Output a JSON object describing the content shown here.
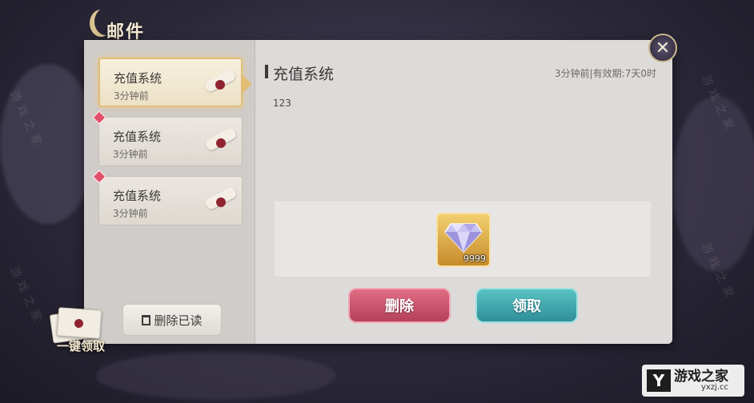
{
  "header": {
    "title": "邮件"
  },
  "close": {
    "icon": "close-icon",
    "glyph": "✕"
  },
  "mail_list": [
    {
      "sender": "充值系统",
      "time": "3分钟前",
      "selected": true,
      "unread": false
    },
    {
      "sender": "充值系统",
      "time": "3分钟前",
      "selected": false,
      "unread": true
    },
    {
      "sender": "充值系统",
      "time": "3分钟前",
      "selected": false,
      "unread": true
    }
  ],
  "actions": {
    "delete_read": "删除已读",
    "claim_all": "一键领取"
  },
  "detail": {
    "title": "充值系统",
    "meta": "3分钟前|有效期:7天0时",
    "body": "123",
    "reward": {
      "icon": "diamond-icon",
      "quantity": "9999"
    },
    "delete_button": "删除",
    "claim_button": "领取"
  },
  "watermark": {
    "logo_letter": "Y",
    "site_name": "游戏之家",
    "site_url": "yxzj.cc"
  },
  "colors": {
    "delete": "#c4506a",
    "claim": "#3fa5ab",
    "selected_border": "#e1bd76",
    "unread": "#e0506a"
  }
}
